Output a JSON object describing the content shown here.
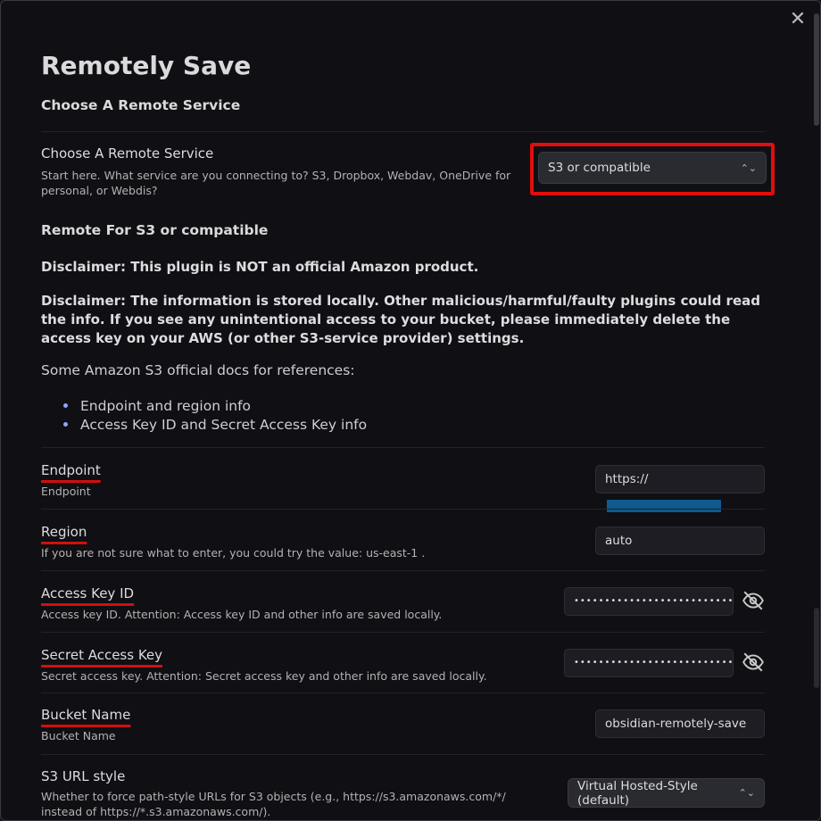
{
  "title": "Remotely Save",
  "section_heading": "Choose A Remote Service",
  "service": {
    "name": "Choose A Remote Service",
    "desc": "Start here. What service are you connecting to? S3, Dropbox, Webdav, OneDrive for personal, or Webdis?",
    "selected": "S3 or compatible"
  },
  "remote_heading": "Remote For S3 or compatible",
  "disclaimer1": "Disclaimer: This plugin is NOT an official Amazon product.",
  "disclaimer2": "Disclaimer: The information is stored locally. Other malicious/harmful/faulty plugins could read the info. If you see any unintentional access to your bucket, please immediately delete the access key on your AWS (or other S3-service provider) settings.",
  "docs_intro": "Some Amazon S3 official docs for references:",
  "docs_links": [
    "Endpoint and region info",
    "Access Key ID and Secret Access Key info"
  ],
  "endpoint": {
    "name": "Endpoint",
    "desc": "Endpoint",
    "value": "https://"
  },
  "region": {
    "name": "Region",
    "desc": "If you are not sure what to enter, you could try the value: us-east-1 .",
    "value": "auto"
  },
  "access_key": {
    "name": "Access Key ID",
    "desc": "Access key ID. Attention: Access key ID and other info are saved locally.",
    "value": "••••••••••••••••••••••••••••••••"
  },
  "secret_key": {
    "name": "Secret Access Key",
    "desc": "Secret access key. Attention: Secret access key and other info are saved locally.",
    "value": "••••••••••••••••••••••••••••••••"
  },
  "bucket": {
    "name": "Bucket Name",
    "desc": "Bucket Name",
    "value": "obsidian-remotely-save"
  },
  "url_style": {
    "name": "S3 URL style",
    "desc": "Whether to force path-style URLs for S3 objects (e.g., https://s3.amazonaws.com/*/ instead of https://*.s3.amazonaws.com/).",
    "selected": "Virtual Hosted-Style (default)"
  },
  "colors": {
    "highlight": "#e30d0d",
    "redacted": "#0f5a8f"
  },
  "icons": {
    "close": "close-icon",
    "eye_off": "eye-off-icon",
    "chevron": "chevron-updown-icon"
  }
}
